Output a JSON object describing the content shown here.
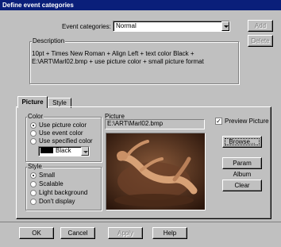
{
  "window": {
    "title": "Define event categories"
  },
  "event_categories": {
    "label": "Event categories:",
    "value": "Normal"
  },
  "buttons": {
    "add": "Add",
    "delete": "Delete",
    "browse": "Browse...",
    "paramount_album": "Param Album",
    "clear": "Clear",
    "ok": "OK",
    "cancel": "Cancel",
    "apply": "Apply",
    "help": "Help"
  },
  "description": {
    "title": "Description",
    "line1": "10pt + Times New Roman + Align Left + text color Black +",
    "line2": "E:\\ART\\Marl02.bmp + use picture color + small picture format"
  },
  "tabs": [
    {
      "label": "Picture"
    },
    {
      "label": "Style"
    }
  ],
  "color_group": {
    "title": "Color",
    "options": [
      "Use picture color",
      "Use event color",
      "Use specified color"
    ],
    "selected_index": 0,
    "swatch_label": "Black",
    "swatch_color": "#000000"
  },
  "style_group": {
    "title": "Style",
    "options": [
      "Small",
      "Scalable",
      "Light background",
      "Don't display"
    ],
    "selected_index": 0
  },
  "picture": {
    "label": "Picture",
    "path": "E:\\ART\\Marl02.bmp"
  },
  "preview": {
    "label": "Preview Picture",
    "checked": true
  }
}
